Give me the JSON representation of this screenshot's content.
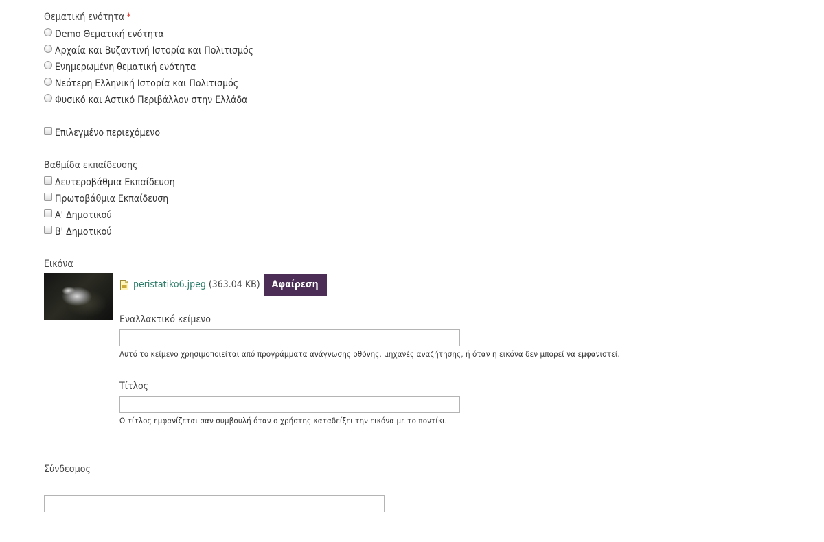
{
  "thematic": {
    "label": "Θεματική ενότητα",
    "required_mark": "*",
    "options": [
      "Demo Θεματική ενότητα",
      "Αρχαία και Βυζαντινή Ιστορία και Πολιτισμός",
      "Ενημερωμένη θεματική ενότητα",
      "Νεότερη Ελληνική Ιστορία και Πολιτισμός",
      "Φυσικό και Αστικό Περιβάλλον στην Ελλάδα"
    ]
  },
  "featured": {
    "label": "Επιλεγμένο περιεχόμενο"
  },
  "education": {
    "label": "Βαθμίδα εκπαίδευσης",
    "options": [
      "Δευτεροβάθμια Εκπαίδευση",
      "Πρωτοβάθμια Εκπαίδευση",
      "Α' Δημοτικού",
      "Β' Δημοτικού"
    ]
  },
  "image": {
    "label": "Εικόνα",
    "file_name": "peristatiko6.jpeg",
    "file_size": "(363.04 KB)",
    "remove_label": "Αφαίρεση",
    "alt": {
      "label": "Εναλλακτικό κείμενο",
      "value": "",
      "description": "Αυτό το κείμενο χρησιμοποιείται από προγράμματα ανάγνωσης οθόνης, μηχανές αναζήτησης, ή όταν η εικόνα δεν μπορεί να εμφανιστεί."
    },
    "title": {
      "label": "Τίτλος",
      "value": "",
      "description": "Ο τίτλος εμφανίζεται σαν συμβουλή όταν ο χρήστης καταδείξει την εικόνα με το ποντίκι."
    }
  },
  "link": {
    "label": "Σύνδεσμος",
    "value": ""
  },
  "colors": {
    "button_bg": "#4b2d55",
    "link": "#2f7d6a",
    "required": "#d9342b"
  }
}
